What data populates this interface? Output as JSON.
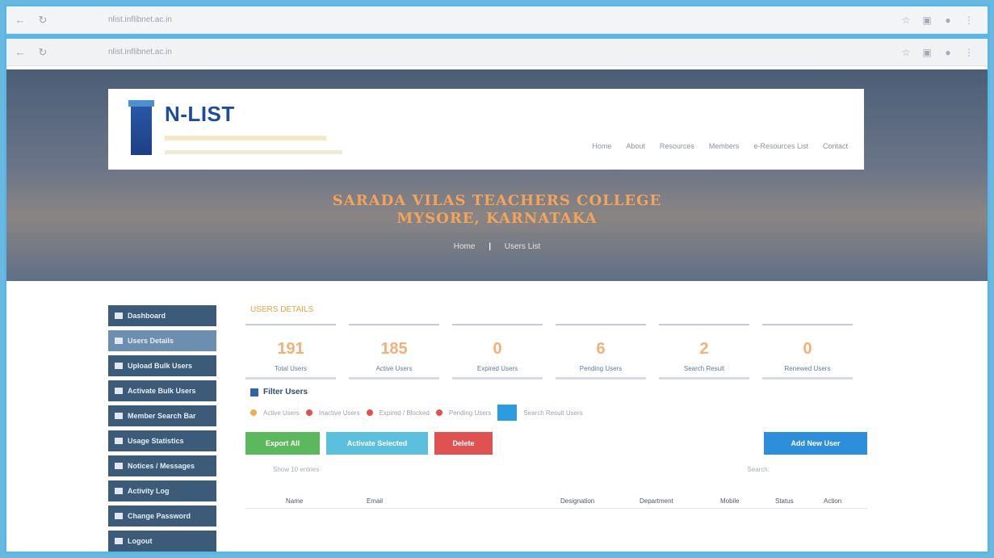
{
  "hero": {
    "title_line1": "SARADA VILAS TEACHERS COLLEGE",
    "title_line2": "MYSORE, KARNATAKA",
    "crumb_home": "Home",
    "crumb_sep": "|",
    "crumb_current": "Users List"
  },
  "brand": {
    "name": "N-LIST"
  },
  "menu": [
    "Home",
    "About",
    "Resources",
    "Members",
    "e-Resources List",
    "Contact"
  ],
  "sidebar": {
    "items": [
      {
        "label": "Dashboard"
      },
      {
        "label": "Users Details"
      },
      {
        "label": "Upload Bulk Users"
      },
      {
        "label": "Activate Bulk Users"
      },
      {
        "label": "Member Search Bar"
      },
      {
        "label": "Usage Statistics"
      },
      {
        "label": "Notices / Messages"
      },
      {
        "label": "Activity Log"
      },
      {
        "label": "Change Password"
      },
      {
        "label": "Logout"
      }
    ]
  },
  "main": {
    "section_title": "USERS DETAILS",
    "stats": [
      {
        "num": "191",
        "label": "Total Users"
      },
      {
        "num": "185",
        "label": "Active Users"
      },
      {
        "num": "0",
        "label": "Expired Users"
      },
      {
        "num": "6",
        "label": "Pending Users"
      },
      {
        "num": "2",
        "label": "Search Result"
      },
      {
        "num": "0",
        "label": "Renewed Users"
      }
    ],
    "filter_title": "Filter Users",
    "filters": [
      "Active Users",
      "Inactive Users",
      "Expired / Blocked",
      "Pending Users",
      "Search Result Users"
    ],
    "buttons": {
      "green": "Export All",
      "cyan": "Activate Selected",
      "red": "Delete",
      "blue": "Add New User"
    },
    "toolbar": {
      "show": "Show 10 entries",
      "search": "Search:"
    },
    "columns": [
      "Name",
      "Email",
      "Designation",
      "Department",
      "Mobile",
      "Status",
      "Action"
    ]
  }
}
